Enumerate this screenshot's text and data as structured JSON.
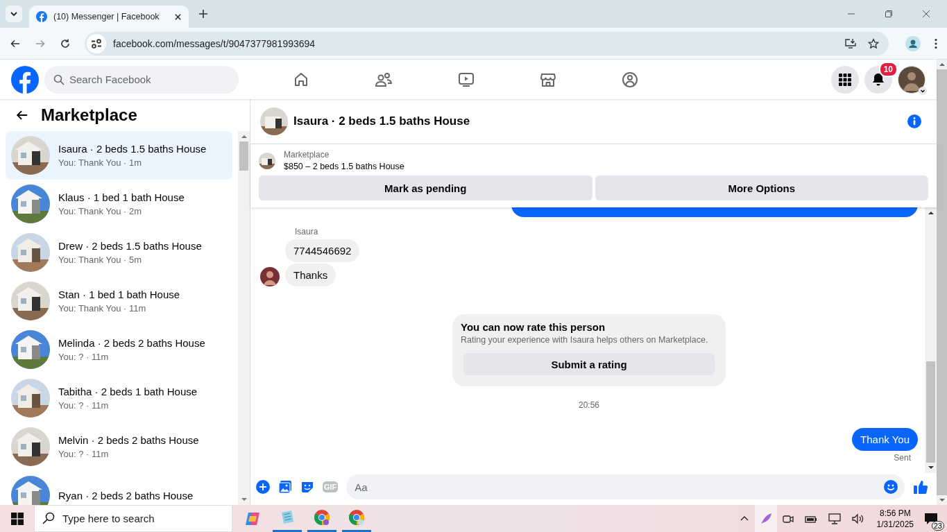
{
  "browser": {
    "tabs": [
      {
        "title": "(10) Messenger | Facebook",
        "selected": true
      }
    ],
    "url": "facebook.com/messages/t/9047377981993694"
  },
  "topbar": {
    "search": {
      "placeholder": "Search Facebook"
    },
    "notifications": "10"
  },
  "sidebar": {
    "title": "Marketplace",
    "items": [
      {
        "title": "Isaura · 2 beds 1.5 baths House",
        "preview": "You: Thank You · 1m",
        "selected": true
      },
      {
        "title": "Klaus · 1 bed 1 bath House",
        "preview": "You: Thank You · 2m",
        "selected": false
      },
      {
        "title": "Drew · 2 beds 1.5 baths House",
        "preview": "You: Thank You · 5m",
        "selected": false
      },
      {
        "title": "Stan · 1 bed 1 bath House",
        "preview": "You: Thank You · 11m",
        "selected": false
      },
      {
        "title": "Melinda · 2 beds 2 baths House",
        "preview": "You: ? · 11m",
        "selected": false
      },
      {
        "title": "Tabitha · 2 beds 1 bath House",
        "preview": "You: ? · 11m",
        "selected": false
      },
      {
        "title": "Melvin · 2 beds 2 baths House",
        "preview": "You: ? · 11m",
        "selected": false
      },
      {
        "title": "Ryan · 2 beds 2 baths House",
        "selected": false
      }
    ]
  },
  "chat": {
    "title": "Isaura · 2 beds 1.5 baths House",
    "listing": {
      "label": "Marketplace",
      "text": "$850 – 2 beds 1.5 baths House",
      "buttons": [
        "Mark as pending",
        "More Options"
      ]
    },
    "messages": [
      {
        "kind": "outgoing_cut"
      },
      {
        "kind": "sender",
        "text": "Isaura"
      },
      {
        "kind": "incoming",
        "text": "7744546692",
        "avatar": false
      },
      {
        "kind": "incoming",
        "text": "Thanks",
        "avatar": true
      },
      {
        "kind": "rating",
        "title": "You can now rate this person",
        "text": "Rating your experience with Isaura helps others on Marketplace.",
        "button": "Submit a rating"
      },
      {
        "kind": "timestamp",
        "text": "20:56"
      },
      {
        "kind": "outgoing",
        "text": "Thank You"
      },
      {
        "kind": "status",
        "text": "Sent"
      }
    ],
    "composer": {
      "placeholder": "Aa",
      "gif": "GIF"
    }
  },
  "taskbar": {
    "search": {
      "placeholder": "Type here to search"
    },
    "time": "8:56 PM",
    "date": "1/31/2025",
    "notifications": "23"
  }
}
